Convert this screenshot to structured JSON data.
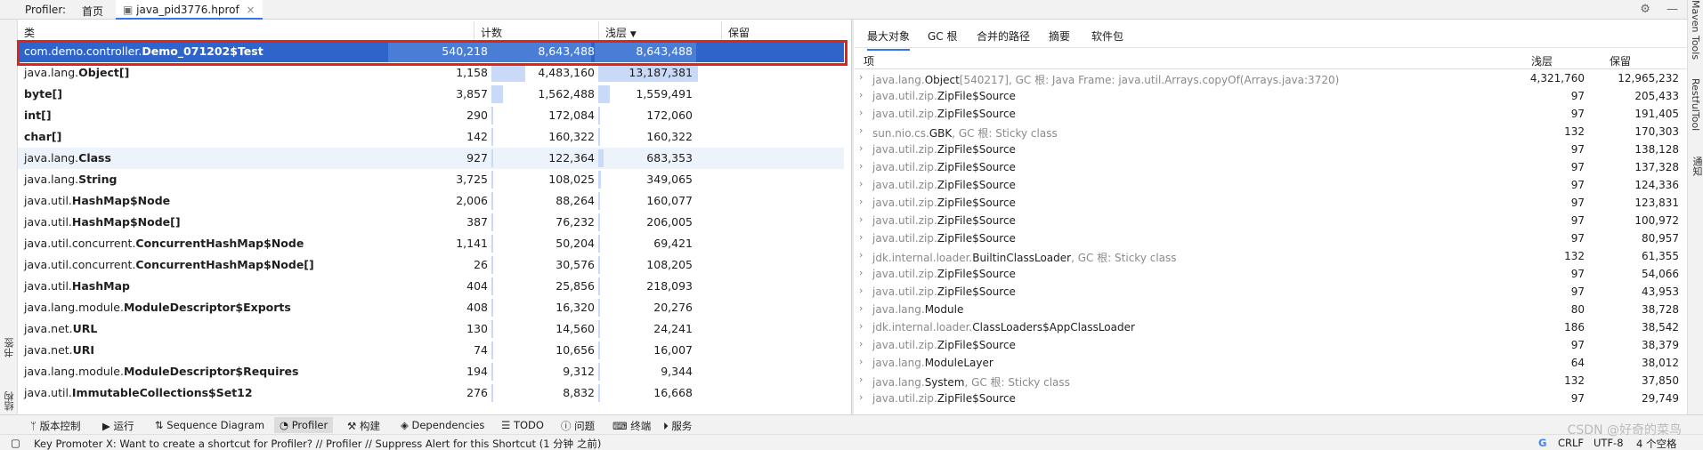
{
  "top_tabs": {
    "profiler": "Profiler:",
    "home": "首页",
    "file": "java_pid3776.hprof"
  },
  "right_strip": [
    "Maven Tools",
    "RestfulTool",
    "通知"
  ],
  "left_strip": [
    "书签",
    "结构"
  ],
  "left_table": {
    "headers": [
      "类",
      "计数",
      "浅层",
      "保留"
    ],
    "rows": [
      {
        "pkg": "com.demo.controller.",
        "cls": "Demo_071202$Test",
        "count": "540,218",
        "shallow": "8,643,488",
        "retained": "8,643,488",
        "shallow_pct": 0.65,
        "retained_pct": 0.66
      },
      {
        "pkg": "java.lang.",
        "cls": "Object[]",
        "count": "1,158",
        "shallow": "4,483,160",
        "retained": "13,187,381",
        "shallow_pct": 0.34,
        "retained_pct": 1.0
      },
      {
        "pkg": "",
        "cls": "byte[]",
        "count": "3,857",
        "shallow": "1,562,488",
        "retained": "1,559,491",
        "shallow_pct": 0.12,
        "retained_pct": 0.12
      },
      {
        "pkg": "",
        "cls": "int[]",
        "count": "290",
        "shallow": "172,084",
        "retained": "172,060",
        "shallow_pct": 0.013,
        "retained_pct": 0.013
      },
      {
        "pkg": "",
        "cls": "char[]",
        "count": "142",
        "shallow": "160,322",
        "retained": "160,322",
        "shallow_pct": 0.012,
        "retained_pct": 0.012
      },
      {
        "pkg": "java.lang.",
        "cls": "Class",
        "count": "927",
        "shallow": "122,364",
        "retained": "683,353",
        "shallow_pct": 0.009,
        "retained_pct": 0.052
      },
      {
        "pkg": "java.lang.",
        "cls": "String",
        "count": "3,725",
        "shallow": "108,025",
        "retained": "349,065",
        "shallow_pct": 0.008,
        "retained_pct": 0.026
      },
      {
        "pkg": "java.util.",
        "cls": "HashMap$Node",
        "count": "2,006",
        "shallow": "88,264",
        "retained": "160,077",
        "shallow_pct": 0.007,
        "retained_pct": 0.012
      },
      {
        "pkg": "java.util.",
        "cls": "HashMap$Node[]",
        "count": "387",
        "shallow": "76,232",
        "retained": "206,005",
        "shallow_pct": 0.006,
        "retained_pct": 0.016
      },
      {
        "pkg": "java.util.concurrent.",
        "cls": "ConcurrentHashMap$Node",
        "count": "1,141",
        "shallow": "50,204",
        "retained": "69,421",
        "shallow_pct": 0.004,
        "retained_pct": 0.005
      },
      {
        "pkg": "java.util.concurrent.",
        "cls": "ConcurrentHashMap$Node[]",
        "count": "26",
        "shallow": "30,576",
        "retained": "108,205",
        "shallow_pct": 0.002,
        "retained_pct": 0.008
      },
      {
        "pkg": "java.util.",
        "cls": "HashMap",
        "count": "404",
        "shallow": "25,856",
        "retained": "218,093",
        "shallow_pct": 0.002,
        "retained_pct": 0.017
      },
      {
        "pkg": "java.lang.module.",
        "cls": "ModuleDescriptor$Exports",
        "count": "408",
        "shallow": "16,320",
        "retained": "20,276",
        "shallow_pct": 0.001,
        "retained_pct": 0.002
      },
      {
        "pkg": "java.net.",
        "cls": "URL",
        "count": "130",
        "shallow": "14,560",
        "retained": "24,241",
        "shallow_pct": 0.001,
        "retained_pct": 0.002
      },
      {
        "pkg": "java.net.",
        "cls": "URI",
        "count": "74",
        "shallow": "10,656",
        "retained": "16,007",
        "shallow_pct": 0.001,
        "retained_pct": 0.001
      },
      {
        "pkg": "java.lang.module.",
        "cls": "ModuleDescriptor$Requires",
        "count": "194",
        "shallow": "9,312",
        "retained": "9,344",
        "shallow_pct": 0.001,
        "retained_pct": 0.001
      },
      {
        "pkg": "java.util.",
        "cls": "ImmutableCollections$Set12",
        "count": "276",
        "shallow": "8,832",
        "retained": "16,668",
        "shallow_pct": 0.001,
        "retained_pct": 0.001
      }
    ]
  },
  "right_tabs": [
    "最大对象",
    "GC 根",
    "合并的路径",
    "摘要",
    "软件包"
  ],
  "right_table": {
    "headers": [
      "项",
      "浅层",
      "保留"
    ],
    "rows": [
      {
        "pkg": "java.lang.",
        "cls": "Object",
        "note": "[540217], GC 根: Java Frame: java.util.Arrays.copyOf(Arrays.java:3720)",
        "shallow": "4,321,760",
        "retained": "12,965,232"
      },
      {
        "pkg": "java.util.zip.",
        "cls": "ZipFile$Source",
        "note": "",
        "shallow": "97",
        "retained": "205,433"
      },
      {
        "pkg": "java.util.zip.",
        "cls": "ZipFile$Source",
        "note": "",
        "shallow": "97",
        "retained": "191,405"
      },
      {
        "pkg": "sun.nio.cs.",
        "cls": "GBK",
        "note": ", GC 根: Sticky class",
        "shallow": "132",
        "retained": "170,303"
      },
      {
        "pkg": "java.util.zip.",
        "cls": "ZipFile$Source",
        "note": "",
        "shallow": "97",
        "retained": "138,128"
      },
      {
        "pkg": "java.util.zip.",
        "cls": "ZipFile$Source",
        "note": "",
        "shallow": "97",
        "retained": "137,328"
      },
      {
        "pkg": "java.util.zip.",
        "cls": "ZipFile$Source",
        "note": "",
        "shallow": "97",
        "retained": "124,336"
      },
      {
        "pkg": "java.util.zip.",
        "cls": "ZipFile$Source",
        "note": "",
        "shallow": "97",
        "retained": "123,831"
      },
      {
        "pkg": "java.util.zip.",
        "cls": "ZipFile$Source",
        "note": "",
        "shallow": "97",
        "retained": "100,972"
      },
      {
        "pkg": "java.util.zip.",
        "cls": "ZipFile$Source",
        "note": "",
        "shallow": "97",
        "retained": "80,957"
      },
      {
        "pkg": "jdk.internal.loader.",
        "cls": "BuiltinClassLoader",
        "note": ", GC 根: Sticky class",
        "shallow": "132",
        "retained": "61,355"
      },
      {
        "pkg": "java.util.zip.",
        "cls": "ZipFile$Source",
        "note": "",
        "shallow": "97",
        "retained": "54,066"
      },
      {
        "pkg": "java.util.zip.",
        "cls": "ZipFile$Source",
        "note": "",
        "shallow": "97",
        "retained": "43,953"
      },
      {
        "pkg": "java.lang.",
        "cls": "Module",
        "note": "",
        "shallow": "80",
        "retained": "38,728"
      },
      {
        "pkg": "jdk.internal.loader.",
        "cls": "ClassLoaders$AppClassLoader",
        "note": "",
        "shallow": "186",
        "retained": "38,542"
      },
      {
        "pkg": "java.util.zip.",
        "cls": "ZipFile$Source",
        "note": "",
        "shallow": "97",
        "retained": "38,379"
      },
      {
        "pkg": "java.lang.",
        "cls": "ModuleLayer",
        "note": "",
        "shallow": "64",
        "retained": "38,012"
      },
      {
        "pkg": "java.lang.",
        "cls": "System",
        "note": ", GC 根: Sticky class",
        "shallow": "132",
        "retained": "37,850"
      },
      {
        "pkg": "java.util.zip.",
        "cls": "ZipFile$Source",
        "note": "",
        "shallow": "97",
        "retained": "29,749"
      }
    ]
  },
  "bottom_tools": [
    "版本控制",
    "运行",
    "Sequence Diagram",
    "Profiler",
    "构建",
    "Dependencies",
    "TODO",
    "问题",
    "终端",
    "服务"
  ],
  "status": {
    "message": "Key Promoter X: Want to create a shortcut for Profiler? // Profiler // Suppress Alert for this Shortcut (1 分钟 之前)",
    "line_sep": "CRLF",
    "encoding": "UTF-8",
    "indent": "4 个空格"
  },
  "watermark": "CSDN @好奇的菜鸟"
}
